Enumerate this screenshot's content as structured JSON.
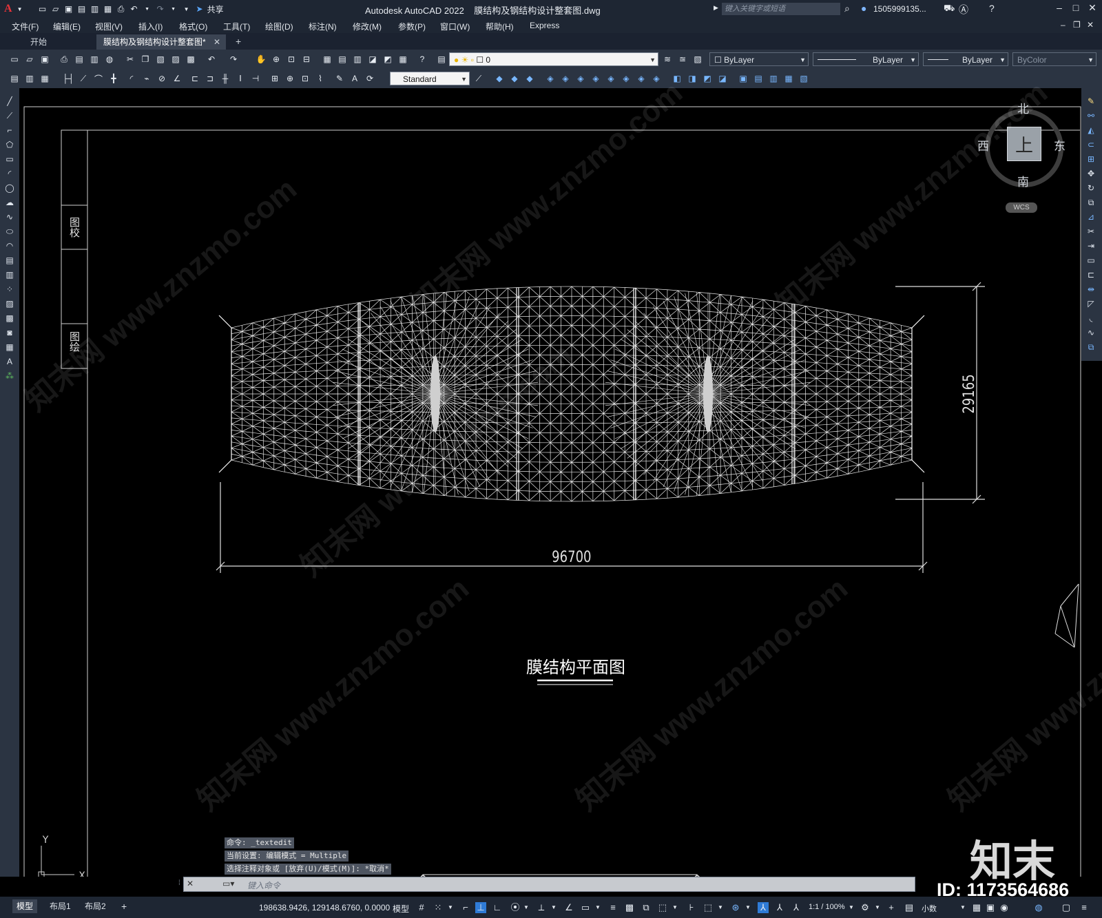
{
  "app": {
    "logo": "A",
    "title": "Autodesk AutoCAD 2022    膜结构及钢结构设计整套图.dwg",
    "search_placeholder": "键入关键字或短语",
    "user": "1505999135...",
    "share_label": "共享"
  },
  "menu": [
    "文件(F)",
    "编辑(E)",
    "视图(V)",
    "插入(I)",
    "格式(O)",
    "工具(T)",
    "绘图(D)",
    "标注(N)",
    "修改(M)",
    "参数(P)",
    "窗口(W)",
    "帮助(H)",
    "Express"
  ],
  "tabs": {
    "start": "开始",
    "active": "膜结构及钢结构设计整套图*",
    "close": "✕",
    "new": "+"
  },
  "toolbar": {
    "layer_value": "0",
    "color": "ByLayer",
    "linetype": "ByLayer",
    "lineweight": "ByLayer",
    "plotstyle": "ByColor",
    "textstyle": "Standard"
  },
  "drawing": {
    "dim_width": "96700",
    "dim_height": "29165",
    "title": "膜结构平面图",
    "title_block_1": "图校",
    "title_block_2": "图绘"
  },
  "viewcube": {
    "north": "北",
    "south": "南",
    "east": "东",
    "west": "西",
    "face": "上",
    "wcs": "WCS"
  },
  "ucs": {
    "y": "Y",
    "x": "X"
  },
  "command": {
    "history": [
      "命令: _textedit",
      "当前设置: 编辑模式 = Multiple",
      "选择注释对象或 [放弃(U)/模式(M)]: *取消*"
    ],
    "placeholder": "键入命令"
  },
  "status": {
    "layout_tabs": [
      "模型",
      "布局1",
      "布局2"
    ],
    "add_layout": "+",
    "coords": "198638.9426, 129148.6760, 0.0000",
    "model": "模型",
    "scale": "1:1 / 100%",
    "units": "小数"
  },
  "watermark": {
    "site": "知末网 www.znzmo.com",
    "brand": "知末",
    "id": "ID: 1173564686"
  },
  "colors": {
    "background": "#000000",
    "chrome": "#1e2633",
    "toolbar": "#2b3442",
    "accent": "#e8333a",
    "active_toggle": "#2f7bd6"
  }
}
